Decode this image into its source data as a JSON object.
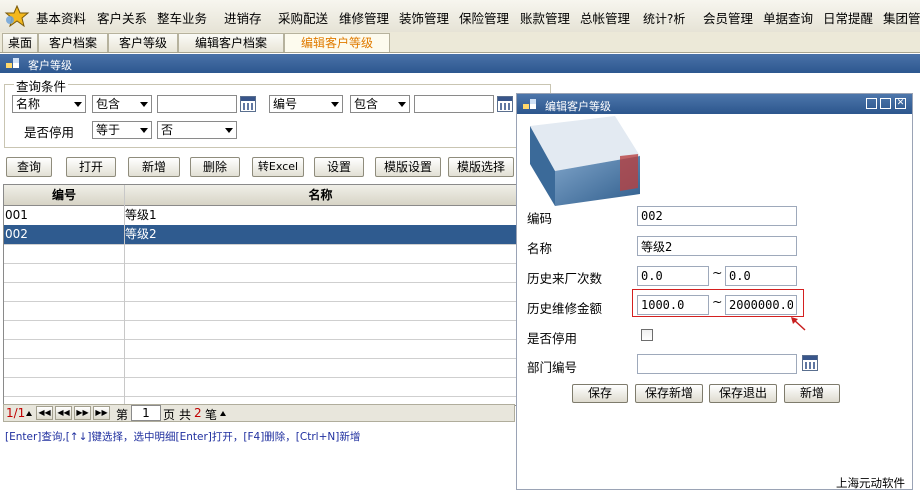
{
  "menu": {
    "items": [
      "基本资料",
      "客户关系",
      "整车业务",
      "进销存",
      "采购配送",
      "维修管理",
      "装饰管理",
      "保险管理",
      "账款管理",
      "总帐管理",
      "统计?析",
      "会员管理",
      "单据查询",
      "日常提醒",
      "集团管"
    ]
  },
  "tabs": [
    "桌面",
    "客户档案",
    "客户等级",
    "编辑客户档案",
    "编辑客户等级"
  ],
  "main_window": {
    "title": "客户等级"
  },
  "query": {
    "legend": "查询条件",
    "row1": {
      "field1": "名称",
      "op1": "包含",
      "value1": "",
      "field2": "编号",
      "op2": "包含",
      "value2": ""
    },
    "row2": {
      "label": "是否停用",
      "op": "等于",
      "value": "否"
    }
  },
  "toolbar": [
    "查询",
    "打开",
    "新增",
    "删除",
    "转Excel",
    "设置",
    "模版设置",
    "模版选择"
  ],
  "grid": {
    "columns": [
      "编号",
      "名称"
    ],
    "rows": [
      {
        "code": "001",
        "name": "等级1"
      },
      {
        "code": "002",
        "name": "等级2"
      }
    ],
    "selected_index": 1
  },
  "pager": {
    "page_info": "1/1",
    "first_label": "第",
    "page": "1",
    "page_unit": "页",
    "total_label": "共",
    "total": "2",
    "total_unit": "笔"
  },
  "hint": "[Enter]查询,[↑↓]键选择，选中明细[Enter]打开，[F4]删除，[Ctrl+N]新增",
  "dialog": {
    "title": "编辑客户等级",
    "fields": {
      "code_label": "编码",
      "code_value": "002",
      "name_label": "名称",
      "name_value": "等级2",
      "visits_label": "历史来厂次数",
      "visits_from": "0.0",
      "visits_to": "0.0",
      "amount_label": "历史维修金额",
      "amount_from": "1000.0",
      "amount_to": "2000000.0",
      "disabled_label": "是否停用",
      "dept_label": "部门编号",
      "dept_value": ""
    },
    "tilde": "~",
    "buttons": [
      "保存",
      "保存新增",
      "保存退出",
      "新增"
    ],
    "footer": "上海元动软件"
  },
  "colors": {
    "title_bar": "#2d578f",
    "selected_row": "#2f5b8f",
    "highlight_box": "#d42020",
    "active_tab": "#e07b00"
  }
}
